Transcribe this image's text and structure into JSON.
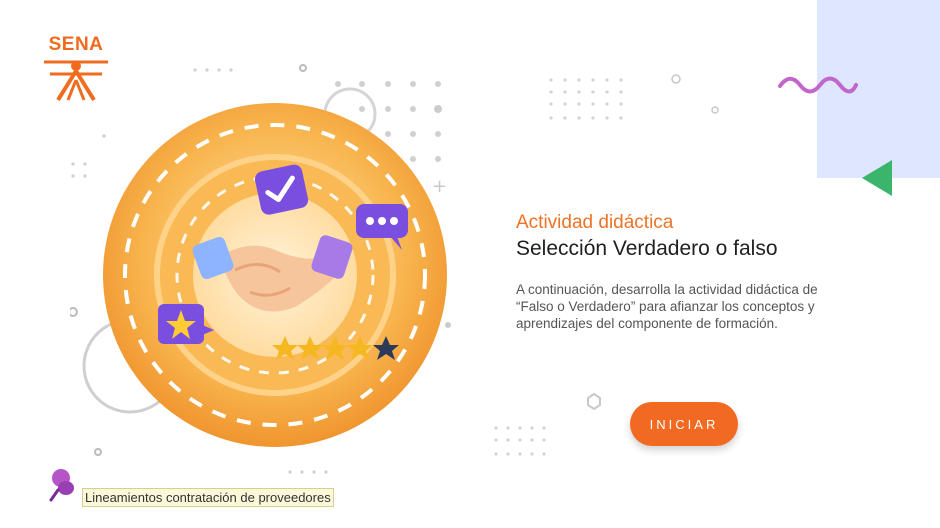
{
  "brand": {
    "logo_text": "SENA"
  },
  "activity": {
    "label": "Actividad didáctica",
    "title": "Selección Verdadero o falso",
    "description": "A continuación, desarrolla la actividad didáctica de “Falso o Verdadero” para afianzar los conceptos y aprendizajes del componente de formación."
  },
  "start_button": {
    "label": "INICIAR"
  },
  "footer": {
    "link_label": "Lineamientos contratación de proveedores"
  },
  "illustration": {
    "stars_filled": 4,
    "stars_total": 5
  },
  "colors": {
    "accent": "#f26a21",
    "title_orange": "#ef7226",
    "purple": "#7a4fe0",
    "blue_panel": "#dfe6ff",
    "green_triangle": "#3bb56b"
  }
}
